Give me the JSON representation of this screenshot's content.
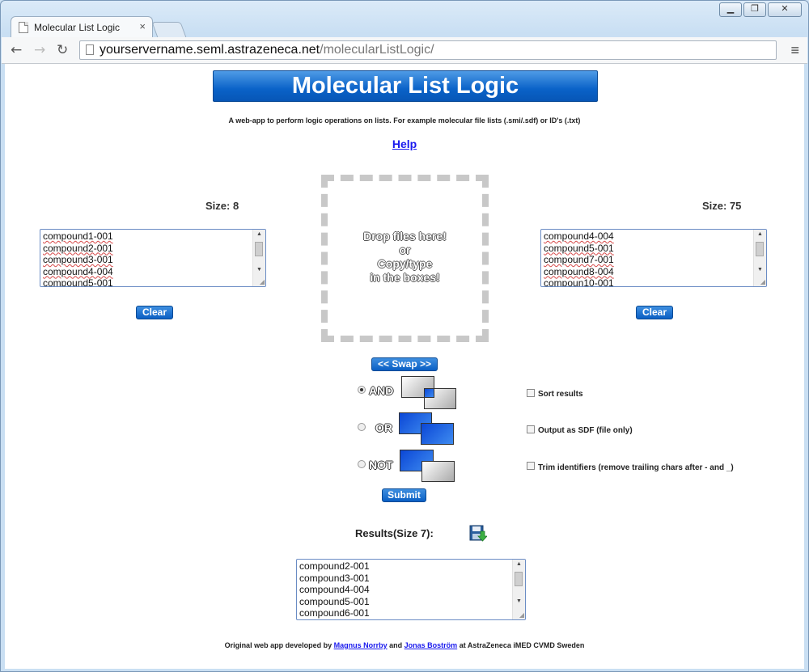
{
  "browser": {
    "tab_title": "Molecular List Logic",
    "tab_close": "×",
    "url_host": "yourservername.seml.astrazeneca.net",
    "url_path": "/molecularListLogic/",
    "win_min": "▁",
    "win_max": "❐",
    "win_close": "✕",
    "back": "←",
    "forward": "→",
    "reload": "↻",
    "menu": "≡"
  },
  "header": {
    "title": "Molecular List Logic",
    "subtitle": "A web-app to perform logic operations on lists. For example molecular file lists (.smi/.sdf) or ID's (.txt)",
    "help": "Help"
  },
  "left": {
    "size_label": "Size: 8",
    "items": [
      "compound1-001",
      "compound2-001",
      "compound3-001",
      "compound4-004",
      "compound5-001"
    ],
    "clear": "Clear"
  },
  "right": {
    "size_label": "Size: 75",
    "items": [
      "compound4-004",
      "compound5-001",
      "compound7-001",
      "compound8-004",
      "compoun10-001"
    ],
    "clear": "Clear"
  },
  "dropzone": {
    "line1": "Drop files here!",
    "line2": "or",
    "line3": "Copy/type",
    "line4": "in the boxes!"
  },
  "controls": {
    "swap": "<< Swap >>",
    "and": "AND",
    "or": "OR",
    "not": "NOT",
    "selected": "AND",
    "submit": "Submit"
  },
  "options": {
    "sort": "Sort results",
    "sdf": "Output as SDF (file only)",
    "trim": "Trim identifiers (remove trailing chars after - and _)"
  },
  "results": {
    "label": "Results(Size 7):",
    "items": [
      "compound2-001",
      "compound3-001",
      "compound4-004",
      "compound5-001",
      "compound6-001"
    ]
  },
  "footer": {
    "prefix": "Original web app developed by",
    "author1": "Magnus Norrby",
    "and": "and",
    "author2": "Jonas Boström",
    "suffix": "at AstraZeneca iMED CVMD Sweden"
  },
  "colors": {
    "accent": "#0a62c8",
    "link": "#1a1aee"
  }
}
